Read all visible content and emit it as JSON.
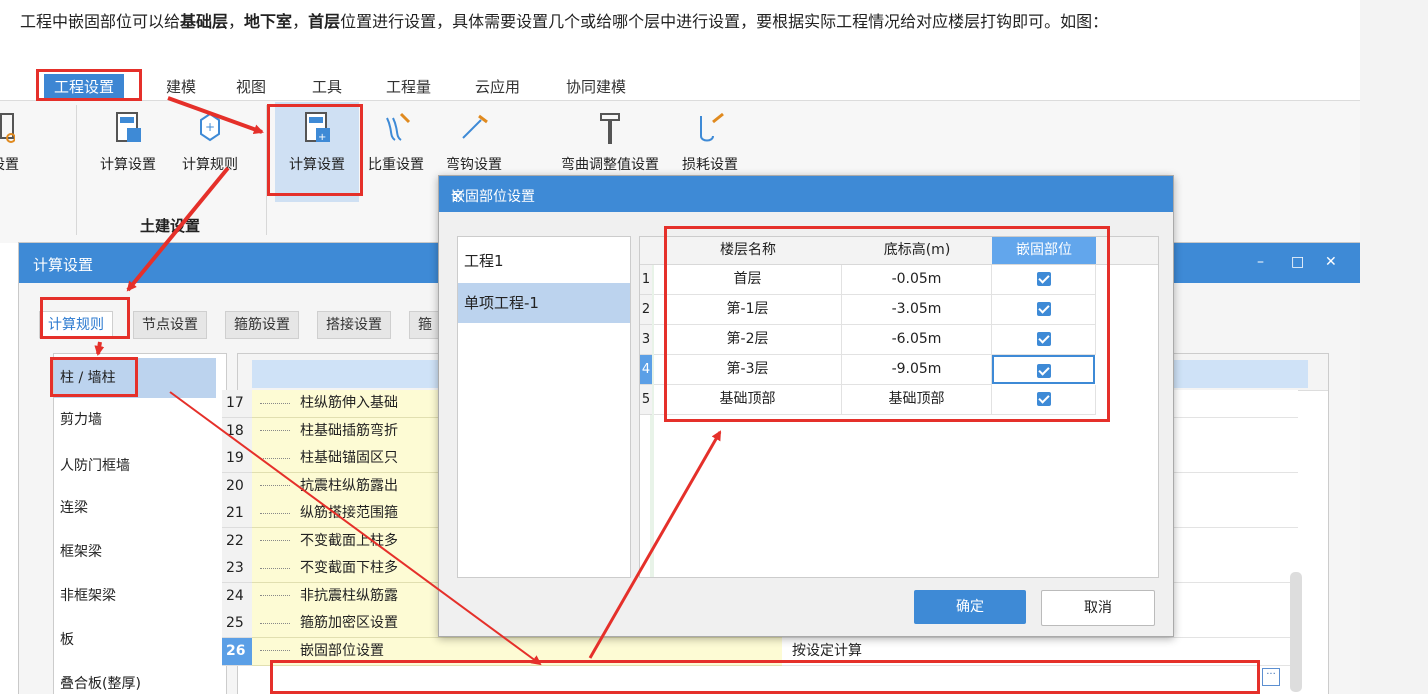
{
  "intro": {
    "part1": "工程中嵌固部位可以给",
    "b1": "基础层",
    "sep1": "，",
    "b2": "地下室",
    "sep2": "，",
    "b3": "首层",
    "part2": "位置进行设置，具体需要设置几个或给哪个层中进行设置，要根据实际工程情况给对应楼层打钩即可。如图："
  },
  "menu": [
    "工程设置",
    "建模",
    "视图",
    "工具",
    "工程量",
    "云应用",
    "协同建模"
  ],
  "toolbar": {
    "partial": "楼设置",
    "calc1": "计算设置",
    "rules": "计算规则",
    "calc2": "计算设置",
    "weight": "比重设置",
    "hook": "弯钩设置",
    "adjust": "弯曲调整值设置",
    "loss": "损耗设置",
    "group_civil": "土建设置"
  },
  "calc_window": {
    "title": "计算设置",
    "tabs": [
      "计算规则",
      "节点设置",
      "箍筋设置",
      "搭接设置",
      "箍"
    ],
    "left_items": [
      "柱 / 墙柱",
      "剪力墙",
      "人防门框墙",
      "连梁",
      "框架梁",
      "非框架梁",
      "板",
      "叠合板(整厚)"
    ],
    "rows": [
      {
        "n": "17",
        "name": "柱纵筋伸入基础",
        "value": ""
      },
      {
        "n": "18",
        "name": "柱基础插筋弯折",
        "value": ""
      },
      {
        "n": "19",
        "name": "柱基础锚固区只",
        "value": ""
      },
      {
        "n": "20",
        "name": "抗震柱纵筋露出",
        "value": ""
      },
      {
        "n": "21",
        "name": "纵筋搭接范围箍",
        "value": ""
      },
      {
        "n": "22",
        "name": "不变截面上柱多",
        "value": ""
      },
      {
        "n": "23",
        "name": "不变截面下柱多",
        "value": ""
      },
      {
        "n": "24",
        "name": "非抗震柱纵筋露",
        "value": ""
      },
      {
        "n": "25",
        "name": "箍筋加密区设置",
        "value": ""
      },
      {
        "n": "26",
        "name": "嵌固部位设置",
        "value": "按设定计算"
      }
    ]
  },
  "modal": {
    "title": "嵌固部位设置",
    "close": "×",
    "projects": [
      "工程1",
      "单项工程-1"
    ],
    "headers": [
      "楼层名称",
      "底标高(m)",
      "嵌固部位"
    ],
    "rows": [
      {
        "n": "1",
        "floor": "首层",
        "elev": "-0.05m",
        "fixed": true
      },
      {
        "n": "2",
        "floor": "第-1层",
        "elev": "-3.05m",
        "fixed": true
      },
      {
        "n": "3",
        "floor": "第-2层",
        "elev": "-6.05m",
        "fixed": true
      },
      {
        "n": "4",
        "floor": "第-3层",
        "elev": "-9.05m",
        "fixed": true
      },
      {
        "n": "5",
        "floor": "基础顶部",
        "elev": "基础顶部",
        "fixed": true
      }
    ],
    "ok": "确定",
    "cancel": "取消"
  },
  "colors": {
    "accent": "#3e8ad6",
    "annotation": "#e5302a",
    "row_yellow": "#fdfbd4"
  }
}
